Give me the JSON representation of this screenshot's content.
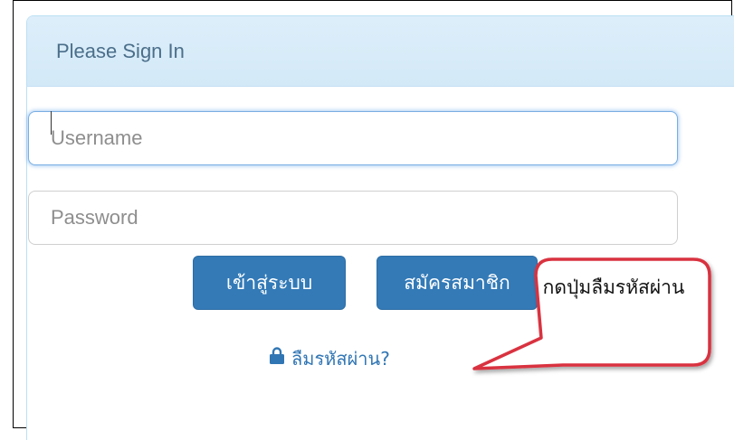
{
  "panel": {
    "title": "Please Sign In"
  },
  "form": {
    "username_placeholder": "Username",
    "password_placeholder": "Password",
    "login_label": "เข้าสู่ระบบ",
    "register_label": "สมัครสมาชิก",
    "forgot_label": "ลืมรหัสผ่าน?",
    "forgot_icon": "lock-icon"
  },
  "callout": {
    "text": "กดปุ่มลืมรหัสผ่าน",
    "border_color": "#d9333f"
  },
  "colors": {
    "primary": "#337ab7",
    "link": "#3176b4",
    "heading_bg": "#d9ecf8",
    "focus": "#66a4e8"
  }
}
